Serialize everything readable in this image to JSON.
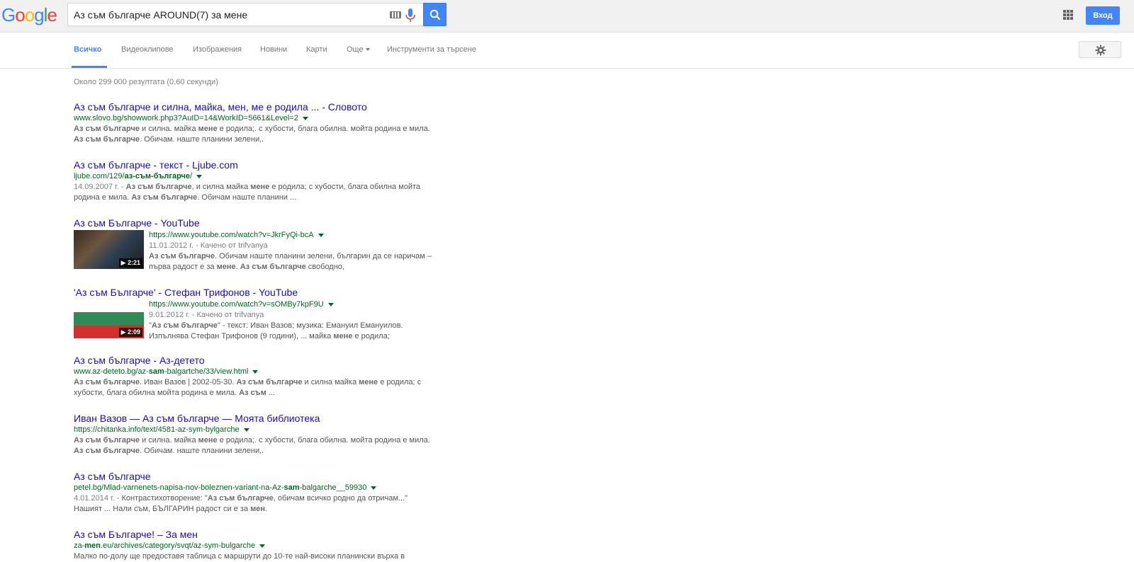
{
  "header": {
    "logo": "Google",
    "search_value": "Аз съм българче AROUND(7) за мене",
    "signin_label": "Вход"
  },
  "tabs": [
    {
      "label": "Всичко",
      "active": true
    },
    {
      "label": "Видеоклипове"
    },
    {
      "label": "Изображения"
    },
    {
      "label": "Новини"
    },
    {
      "label": "Карти"
    },
    {
      "label": "Още"
    },
    {
      "label": "Инструменти за търсене"
    }
  ],
  "stats": "Около 299 000 резултата (0,60 секунди)",
  "results": [
    {
      "title": "Аз съм българче и силна, майка, мен, ме е родила ... - Словото",
      "url": "www.slovo.bg/showwork.php3?AuID=14&WorkID=5661&Level=2",
      "line1": "<b>Аз съм българче</b> и силна. майка <b>мене</b> е родила;. с хубости, блага обилна. мойта родина е мила.",
      "line2": "<b>Аз съм българче</b>. Обичам. наште планини зелени,."
    },
    {
      "title": "Аз съм българче - текст - Ljube.com",
      "url_html": "ljube.com/129/<b>аз-съм-българче</b>/",
      "line1": "<span class=\"r-meta\">14.09.2007 г. - </span><b>Аз съм българче</b>, и силна майка <b>мене</b> е родила; с хубости, блага обилна мойта",
      "line2": "родина е мила. <b>Аз съм българче</b>. Обичам наште планини ..."
    },
    {
      "title": "Аз съм Българче - YouTube",
      "url": "https://www.youtube.com/watch?v=JkrFyQi-bcA",
      "meta": "11.01.2012 г. - Качено от trifvanya",
      "line1": "<b>Аз съм българче</b>. Обичам наште планини зелени, българин да се наричам –",
      "line2": "първа радост е за <b>мене</b>. <b>Аз съм българче</b> свободно,",
      "duration": "▶ 2:21"
    },
    {
      "title": "'Аз съм Българче' - Стефан Трифонов - YouTube",
      "url": "https://www.youtube.com/watch?v=sOMBy7kpF9U",
      "meta": "9.01.2012 г. - Качено от trifvanya",
      "line1": "\"<b>Аз съм българче</b>\" - текст: Иван Вазов; музика: Емануил Емануилов.",
      "line2": "Изпълнява Стефан Трифонов (9 години), ... майка <b>мене</b> е родила;",
      "duration": "▶ 2:09"
    },
    {
      "title": "Аз съм българче - Аз-детето",
      "url_html": "www.az-deteto.bg/az-<b>sam</b>-balgartche/33/view.html",
      "line1": "<b>Аз съм българче</b>. Иван Вазов | 2002-05-30. <b>Аз съм българче</b> и силна майка <b>мене</b> е родила; с",
      "line2": "хубости, блага обилна мойта родина е мила. <b>Аз съм</b> ..."
    },
    {
      "title": "Иван Вазов — Аз съм българче — Моята библиотека",
      "url": "https://chitanka.info/text/4581-az-sym-bylgarche",
      "line1": "<b>Аз съм българче</b> и силна. майка <b>мене</b> е родила;. с хубости, блага обилна. мойта родина е мила.",
      "line2": "<b>Аз съм българче</b>. Обичам. наште планини зелени,."
    },
    {
      "title": "Аз съм българче",
      "url_html": "petel.bg/Mlad-varnenets-napisa-nov-boleznen-variant-na-Az-<b>sam</b>-balgarche__59930",
      "line1": "<span class=\"r-meta\">4.01.2014 г. - </span>Контрастихотворение: \"<b>Аз съм българче</b>, обичам всичко родно да отричам...\"",
      "line2": "Нашият ... Нали съм, БЪЛГАРИН радост си е за <b>мен</b>."
    },
    {
      "title": "Аз съм Българче! – За мен",
      "url_html": "za-<b>men</b>.eu/archives/category/svqt/az-sym-bulgarche",
      "line1": "Малко по-долу ще предоставя таблица с маршрути до 10-те най-високи планински върха в"
    }
  ],
  "colors": {
    "link": "#1a0dab",
    "url": "#006621",
    "accent": "#4285f4"
  }
}
